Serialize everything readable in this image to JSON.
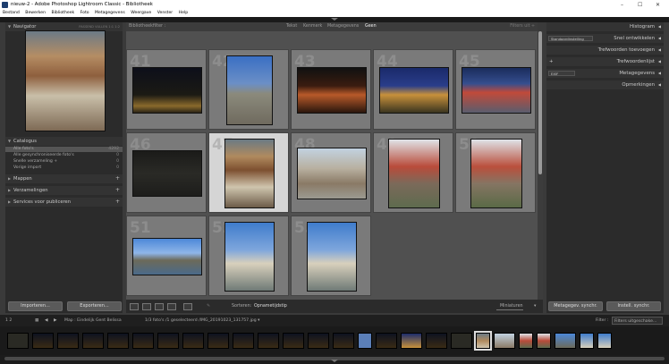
{
  "window": {
    "title": "nieuw-2 - Adobe Photoshop Lightroom Classic - Bibliotheek",
    "controls": [
      "–",
      "☐",
      "✕"
    ]
  },
  "menu": [
    "Bestand",
    "Bewerken",
    "Bibliotheek",
    "Foto",
    "Metagegevens",
    "Weergave",
    "Venster",
    "Help"
  ],
  "left": {
    "navigator": {
      "label": "Navigator",
      "zoom_options": "PASSEND  VULLEN  1:1  1:2"
    },
    "catalog": {
      "label": "Catalogus",
      "rows": [
        {
          "label": "Alle foto's",
          "count": "4292"
        },
        {
          "label": "Alle gesynchroniseerde foto's",
          "count": "0"
        },
        {
          "label": "Snelle verzameling +",
          "count": "0"
        },
        {
          "label": "Vorige import",
          "count": "0"
        }
      ]
    },
    "folders": "Mappen",
    "collections": "Verzamelingen",
    "publish": "Services voor publiceren",
    "import_btn": "Importeren...",
    "export_btn": "Exporteren..."
  },
  "filter": {
    "title": "Bibliotheekfilter :",
    "tabs": [
      "Tekst",
      "Kenmerk",
      "Metagegevens",
      "Geen"
    ],
    "active": "Geen",
    "preset": "Filters uit ÷"
  },
  "grid": [
    {
      "num": "41",
      "thumb": "night-trees",
      "x": 0,
      "y": 0
    },
    {
      "num": "42",
      "thumb": "tower-blue",
      "x": 1,
      "y": 0
    },
    {
      "num": "43",
      "thumb": "night-arch",
      "x": 2,
      "y": 0
    },
    {
      "num": "44",
      "thumb": "night-canal",
      "x": 3,
      "y": 0
    },
    {
      "num": "45",
      "thumb": "night-mall",
      "x": 4,
      "y": 0
    },
    {
      "num": "46",
      "thumb": "dark-stone",
      "x": 0,
      "y": 1
    },
    {
      "num": "47",
      "thumb": "church-books",
      "x": 1,
      "y": 1,
      "selected": true
    },
    {
      "num": "48",
      "thumb": "romanesque",
      "x": 2,
      "y": 1
    },
    {
      "num": "49",
      "thumb": "red-tower",
      "x": 3,
      "y": 1
    },
    {
      "num": "50",
      "thumb": "red-tower-2",
      "x": 4,
      "y": 1
    },
    {
      "num": "51",
      "thumb": "bridge-river",
      "x": 0,
      "y": 2
    },
    {
      "num": "52",
      "thumb": "parliament",
      "x": 1,
      "y": 2
    },
    {
      "num": "53",
      "thumb": "parliament-2",
      "x": 2,
      "y": 2
    }
  ],
  "toolbar": {
    "sort_label": "Sorteren:",
    "sort_value": "Opnametijdstip",
    "thumb_label": "Miniaturen"
  },
  "right": {
    "histogram": "Histogram",
    "quick_dev": "Snel ontwikkelen",
    "quick_sel": "Standaardinstelling",
    "keywording": "Trefwoorden toevoegen",
    "keyword_list": "Trefwoordenlijst",
    "metadata": "Metagegevens",
    "meta_sel": "EXIF",
    "comments": "Opmerkingen",
    "sync_meta": "Metagegev. synchr.",
    "sync_settings": "Instell. synchr."
  },
  "filmstrip_info": {
    "pages": "1  2",
    "source": "Map : Eindelijk Gent Belissa",
    "selection": "1/3 foto's /1 geselecteerd /IMG_20191023_131757.jpg ▾",
    "filter_label": "Filter :",
    "filter_value": "Filters uitgeschake..."
  },
  "filmstrip": [
    "dark",
    "night",
    "night",
    "night",
    "night",
    "night",
    "night",
    "night",
    "night",
    "night",
    "night",
    "night",
    "night",
    "night",
    "tower",
    "night",
    "canal",
    "night",
    "dark",
    "church",
    "romanesque",
    "redtower",
    "redtower",
    "bridge",
    "parliament",
    "parliament"
  ],
  "colors": {
    "accent": "#d5d5d5",
    "panel": "#2b2b2b",
    "bg": "#505050"
  }
}
